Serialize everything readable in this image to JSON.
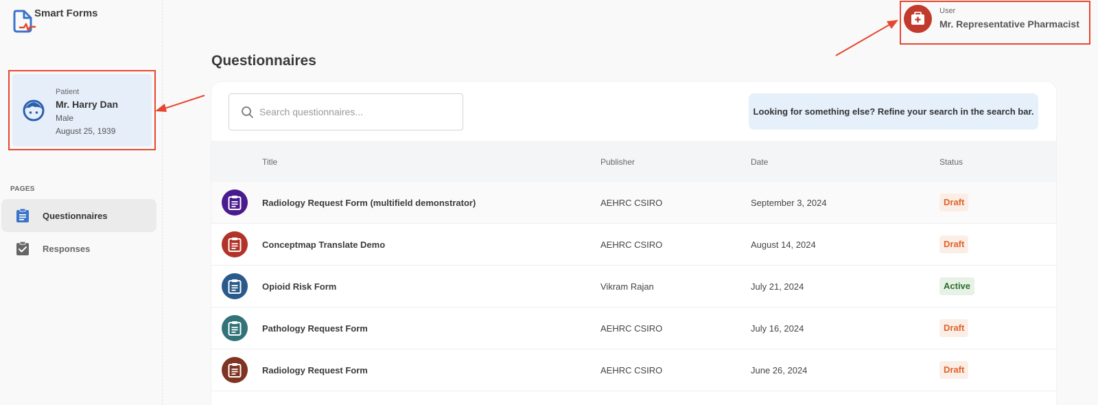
{
  "app": {
    "name": "Smart Forms"
  },
  "patient": {
    "kicker": "Patient",
    "name": "Mr. Harry Dan",
    "gender": "Male",
    "dob": "August 25, 1939"
  },
  "sidebar": {
    "section_label": "PAGES",
    "items": [
      {
        "label": "Questionnaires",
        "icon": "clipboard-icon",
        "active": true
      },
      {
        "label": "Responses",
        "icon": "clipboard-check-icon",
        "active": false
      }
    ]
  },
  "user": {
    "kicker": "User",
    "name": "Mr. Representative Pharmacist",
    "icon": "medical-bag-icon"
  },
  "main": {
    "title": "Questionnaires",
    "search": {
      "placeholder": "Search questionnaires..."
    },
    "hint": "Looking for something else? Refine your search in the search bar.",
    "columns": [
      "Title",
      "Publisher",
      "Date",
      "Status"
    ],
    "rows": [
      {
        "title": "Radiology Request Form (multifield demonstrator)",
        "publisher": "AEHRC CSIRO",
        "date": "September 3, 2024",
        "status": "Draft",
        "icon_color": "#4a1b8f"
      },
      {
        "title": "Conceptmap Translate Demo",
        "publisher": "AEHRC CSIRO",
        "date": "August 14, 2024",
        "status": "Draft",
        "icon_color": "#b23327"
      },
      {
        "title": "Opioid Risk Form",
        "publisher": "Vikram Rajan",
        "date": "July 21, 2024",
        "status": "Active",
        "icon_color": "#2a5a8c"
      },
      {
        "title": "Pathology Request Form",
        "publisher": "AEHRC CSIRO",
        "date": "July 16, 2024",
        "status": "Draft",
        "icon_color": "#327379"
      },
      {
        "title": "Radiology Request Form",
        "publisher": "AEHRC CSIRO",
        "date": "June 26, 2024",
        "status": "Draft",
        "icon_color": "#7f3322"
      }
    ]
  },
  "colors": {
    "accent": "#3a73c9",
    "highlight_box": "#e5462f",
    "draft": "#e0622a",
    "active": "#2f6b2f"
  }
}
